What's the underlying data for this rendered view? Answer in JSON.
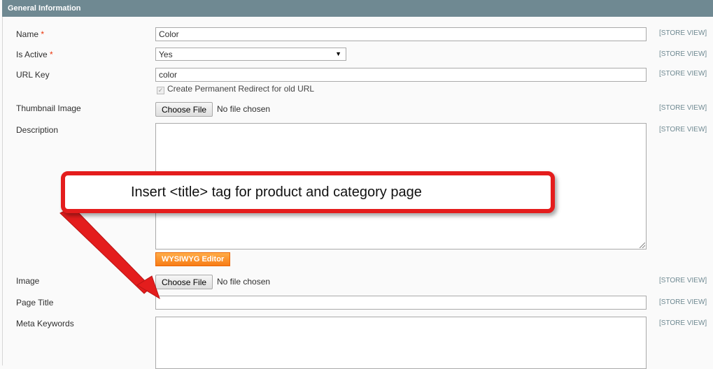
{
  "section": {
    "title": "General Information"
  },
  "fields": {
    "name": {
      "label": "Name",
      "required": "*",
      "value": "Color",
      "scope": "[STORE VIEW]"
    },
    "is_active": {
      "label": "Is Active",
      "required": "*",
      "value": "Yes",
      "scope": "[STORE VIEW]"
    },
    "url_key": {
      "label": "URL Key",
      "value": "color",
      "scope": "[STORE VIEW]",
      "redirect_label": "Create Permanent Redirect for old URL",
      "redirect_checked": true
    },
    "thumbnail": {
      "label": "Thumbnail Image",
      "button": "Choose File",
      "status": "No file chosen",
      "scope": "[STORE VIEW]"
    },
    "description": {
      "label": "Description",
      "value": "",
      "scope": "[STORE VIEW]",
      "editor_button": "WYSIWYG Editor"
    },
    "image": {
      "label": "Image",
      "button": "Choose File",
      "status": "No file chosen",
      "scope": "[STORE VIEW]"
    },
    "page_title": {
      "label": "Page Title",
      "value": "",
      "scope": "[STORE VIEW]"
    },
    "meta_keywords": {
      "label": "Meta Keywords",
      "value": "",
      "scope": "[STORE VIEW]"
    }
  },
  "annotation": {
    "text": "Insert <title> tag for product and category page",
    "color": "#e41d1d"
  },
  "icons": {
    "select_arrow": "▼",
    "checkbox_check": "✓"
  },
  "colors": {
    "header": "#6f8992",
    "required": "#eb340a",
    "button": "#f77c16"
  }
}
